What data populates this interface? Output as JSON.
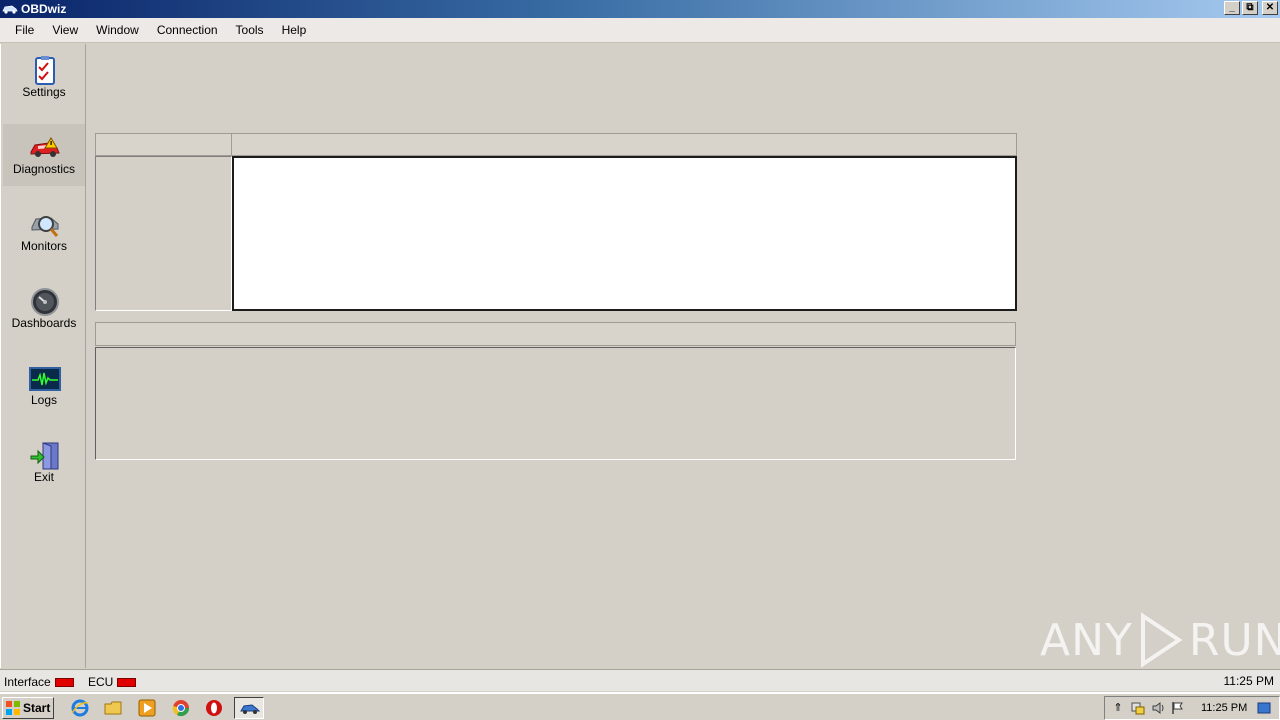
{
  "window": {
    "title": "OBDwiz",
    "controls": [
      "_",
      "⧉",
      "✕"
    ]
  },
  "menu": [
    "File",
    "View",
    "Window",
    "Connection",
    "Tools",
    "Help"
  ],
  "sidebar": [
    {
      "label": "Settings",
      "icon": "settings-checklist-icon",
      "active": false
    },
    {
      "label": "Diagnostics",
      "icon": "car-warning-icon",
      "active": true
    },
    {
      "label": "Monitors",
      "icon": "magnifier-icon",
      "active": false
    },
    {
      "label": "Dashboards",
      "icon": "gauge-icon",
      "active": false
    },
    {
      "label": "Logs",
      "icon": "waveform-icon",
      "active": false
    },
    {
      "label": "Exit",
      "icon": "exit-door-icon",
      "active": false
    }
  ],
  "status": {
    "interface_label": "Interface",
    "ecu_label": "ECU",
    "time": "11:25 PM",
    "indicator_color": "#e00000"
  },
  "taskbar": {
    "start_label": "Start",
    "clock": "11:25 PM"
  },
  "watermark": {
    "text_left": "ANY",
    "text_right": "RUN"
  }
}
